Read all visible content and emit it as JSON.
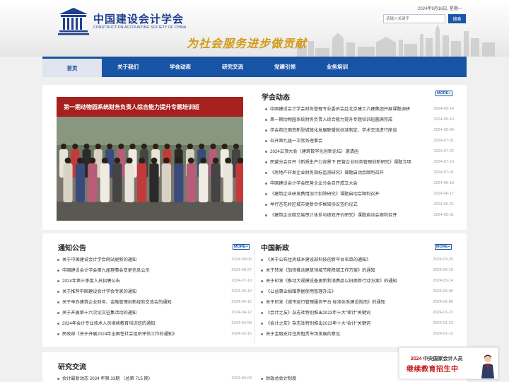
{
  "header": {
    "org_name": "中国建设会计学会",
    "org_name_en": "CONSTRUCTION ACCOUNTING SOCIETY OF CHINA",
    "slogan": "为社会服务进步做贡献",
    "date": "2024年9月16日, 星期一",
    "search_placeholder": "请输入关键字",
    "search_button": "搜索"
  },
  "nav": {
    "items": [
      "首页",
      "关于我们",
      "学会动态",
      "研究交流",
      "党建引领",
      "业务培训"
    ],
    "active": "首页"
  },
  "slider": {
    "banner_text": "第一期动物园系统财务负责人综合能力提升专题培训班",
    "pages": [
      "1",
      "2",
      "3",
      "4",
      "5",
      "6",
      "7",
      "8",
      "9",
      "10"
    ],
    "active_page": "1"
  },
  "society_news": {
    "title": "学会动态",
    "more": "MORE+",
    "items": [
      {
        "text": "中国建设会计学会财务管理专业委员会赴北京建工六建集团开展课题调研",
        "date": "2024-09-14"
      },
      {
        "text": "第一期动物园系统财务负责人综合能力提升专题培训班圆满完成",
        "date": "2024-09-13"
      },
      {
        "text": "学会前往国资新型城镇化发展联盟就标准制定、学术交流进行座谈",
        "date": "2024-09-04"
      },
      {
        "text": "召开第九届一次常务理事会",
        "date": "2024-07-31"
      },
      {
        "text": "2024云顶大会（建筑数字化创新论坛）邀请函",
        "date": "2024-07-22"
      },
      {
        "text": "民营分会召开《新质生产力背景下 民营企业财务管理创新研究》课题立项",
        "date": "2024-07-10"
      },
      {
        "text": "《房地产开发企业财务指标监测研究》课题启动会顺利召开",
        "date": "2024-07-01"
      },
      {
        "text": "中国建设会计学会民营企业分会召开成立大会",
        "date": "2024-06-19"
      },
      {
        "text": "《建筑企业研发费用加计扣除研究》课题启动会顺利召开",
        "date": "2024-06-17"
      },
      {
        "text": "举行杏花岭区城市更新合作框架协议签约仪式",
        "date": "2024-05-31"
      },
      {
        "text": "《建筑企业碳交易审计体系与绩效评价研究》课题启动会顺利召开",
        "date": "2024-05-31"
      }
    ]
  },
  "notices": {
    "title": "通知公告",
    "more": "MORE+",
    "items": [
      {
        "text": "关于中国建设会计学会网站更新的通知",
        "date": "2024-09-06"
      },
      {
        "text": "中国建设会计学会第九届理事会变更信息公示",
        "date": "2024-08-27"
      },
      {
        "text": "2024年第三季度人员招聘公告",
        "date": "2024-07-19"
      },
      {
        "text": "关于推荐中国建设会计学会专家的通知",
        "date": "2024-05-10"
      },
      {
        "text": "关于举办建筑企业财务、金融管理创新经验交流会的通知",
        "date": "2024-04-12"
      },
      {
        "text": "关于开展第十六次论文征集活动的通知",
        "date": "2024-04-12"
      },
      {
        "text": "2024年会计专业技术人员继续教育培训班的通知",
        "date": "2024-04-09"
      },
      {
        "text": "民政部《关于开展2024年全国性社会组织评估工作的通知》",
        "date": "2024-03-15"
      }
    ]
  },
  "policies": {
    "title": "中国新政",
    "more": "MORE+",
    "items": [
      {
        "text": "《关于公布住房城乡建设部科技创新平台名单的通知》",
        "date": "2024-03-25"
      },
      {
        "text": "关于转发《加快推动建筑领域节能降碳工作方案》的通知",
        "date": "2024-03-15"
      },
      {
        "text": "关于印发《推动大规模设备更新和消费品以旧换新行动方案》的通知",
        "date": "2024-03-14"
      },
      {
        "text": "《公益事业捐赠票据使用管理办法》",
        "date": "2024-03-05"
      },
      {
        "text": "关于印发《城市运行管理服务平台 标准体系建设指南》的通知",
        "date": "2024-02-09"
      },
      {
        "text": "《会计之友》杂志社特别推出2023年十大\"审计\"关键词",
        "date": "2024-01-22"
      },
      {
        "text": "《会计之友》杂志社特别推出2023年十大\"会计\"关键词",
        "date": "2024-01-22"
      },
      {
        "text": "关于金融支持住房租赁市场发展的意见",
        "date": "2024-01-12"
      }
    ]
  },
  "research": {
    "title": "研究交流",
    "items": [
      {
        "text": "会计最新动态 2024 年第 33期 （总第 715 期）",
        "date": "2024-09-03"
      }
    ],
    "items_right": [
      {
        "text": "财政总会计制度",
        "date": ""
      }
    ]
  },
  "ad": {
    "year": "2024",
    "line1": "中央国家会计人员",
    "line2": "继续教育招生中"
  }
}
